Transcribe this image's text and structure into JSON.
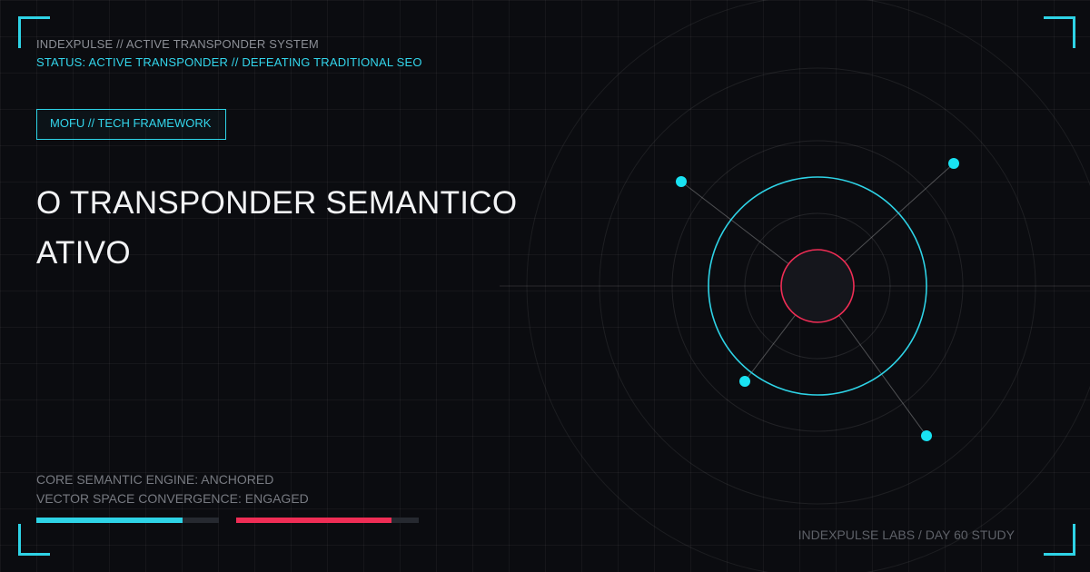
{
  "header": {
    "system_line": "INDEXPULSE // ACTIVE TRANSPONDER SYSTEM",
    "status_line": "STATUS: ACTIVE TRANSPONDER // DEFEATING TRADITIONAL SEO"
  },
  "badge": {
    "label": "MOFU // TECH FRAMEWORK"
  },
  "title": {
    "line1": "O TRANSPONDER SEMANTICO",
    "line2": "ATIVO"
  },
  "diagnostics": {
    "line1": "CORE SEMANTIC ENGINE: ANCHORED",
    "line2": "VECTOR SPACE CONVERGENCE: ENGAGED"
  },
  "progress": [
    {
      "label": "cyan",
      "value": 0.8,
      "color": "#2ed3e6"
    },
    {
      "label": "red",
      "value": 0.85,
      "color": "#ef2d55"
    }
  ],
  "footer": {
    "text": "INDEXPULSE LABS / DAY 60 STUDY"
  },
  "colors": {
    "accent": "#2ed3e6",
    "alert": "#ef2d55",
    "background": "#0b0c10"
  }
}
